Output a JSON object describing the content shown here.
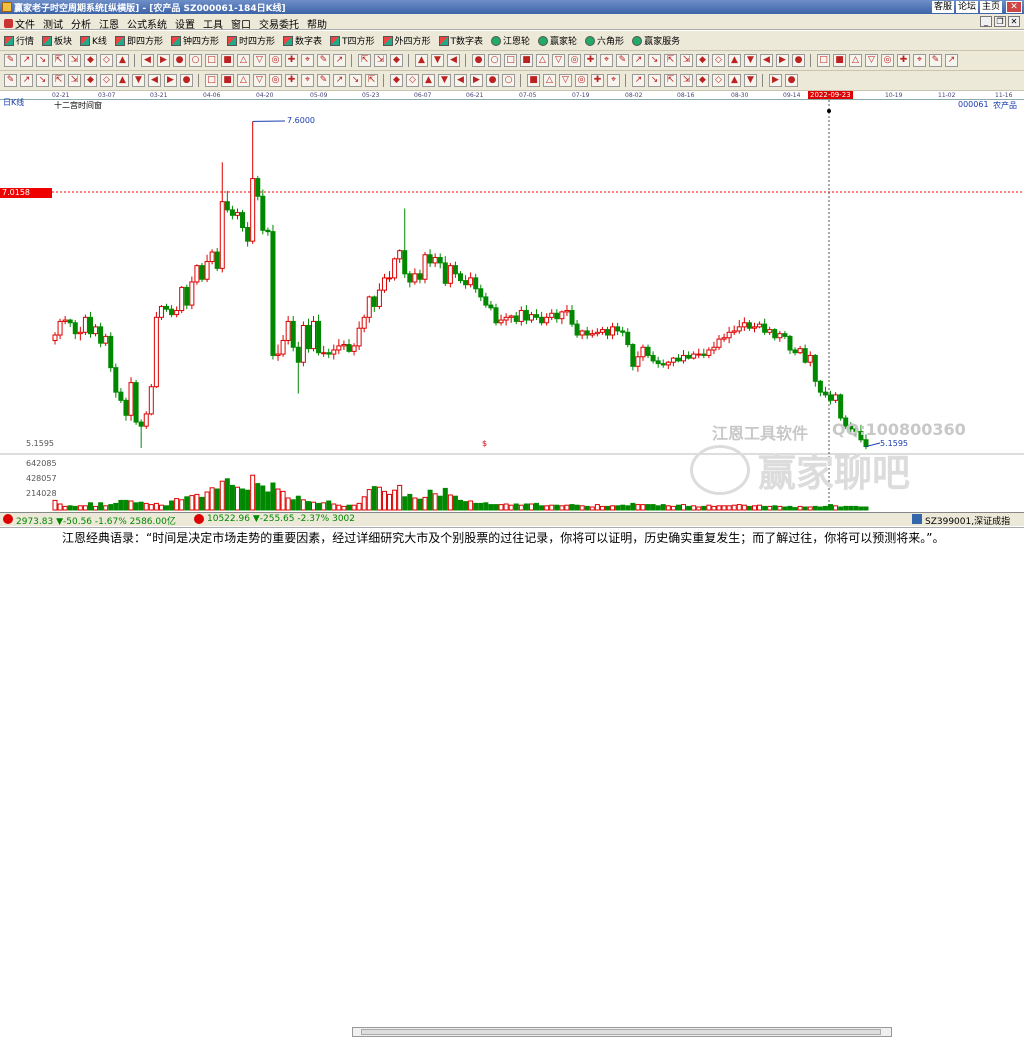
{
  "window": {
    "title": "赢家老子时空周期系统[纵横版] - [农产品   SZ000061-184日K线]",
    "links": [
      "客服",
      "论坛",
      "主页"
    ]
  },
  "menu": [
    "文件",
    "测试",
    "分析",
    "江恩",
    "公式系统",
    "设置",
    "工具",
    "窗口",
    "交易委托",
    "帮助"
  ],
  "toolbar1": [
    "行情",
    "板块",
    "K线",
    "即四方形",
    "钟四方形",
    "时四方形",
    "数字表",
    "T四方形",
    "外四方形",
    "T数字表",
    "江恩轮",
    "赢家轮",
    "六角形",
    "赢家服务"
  ],
  "date_axis": {
    "ticks": [
      "02-21",
      "03-07",
      "03-21",
      "04-06",
      "04-20",
      "05-09",
      "05-23",
      "06-07",
      "06-21",
      "07-05",
      "07-19",
      "08-02",
      "08-16",
      "08-30",
      "09-14",
      "10-19",
      "11-02",
      "11-16"
    ],
    "highlight": "2022-09-23"
  },
  "chart": {
    "period_label": "日K线",
    "window_label": "十二宫时间窗",
    "code": "000061",
    "name": "农产品",
    "high_label": "7.6000",
    "low_label": "5.1595",
    "price_flag": "7.0158",
    "left_low": "5.1595",
    "vol_labels": [
      "642085",
      "428057",
      "214028"
    ],
    "marker": "$"
  },
  "chart_data": {
    "type": "candlestick",
    "open": [
      5.95,
      5.99,
      6.09,
      6.1,
      6.08,
      6.0,
      6.01,
      6.12,
      6.0,
      6.05,
      5.93,
      5.98,
      5.75,
      5.57,
      5.51,
      5.4,
      5.64,
      5.35,
      5.32,
      5.41,
      5.61,
      6.12,
      6.2,
      6.18,
      6.14,
      6.17,
      6.34,
      6.21,
      6.38,
      6.5,
      6.4,
      6.53,
      6.6,
      6.48,
      6.97,
      6.91,
      6.87,
      6.89,
      6.78,
      6.68,
      7.14,
      7.01,
      6.76,
      6.75,
      5.84,
      5.85,
      5.95,
      6.09,
      5.9,
      5.79,
      6.06,
      5.89,
      6.09,
      5.86,
      5.86,
      5.85,
      5.88,
      5.91,
      5.92,
      5.87,
      5.91,
      6.04,
      6.12,
      6.27,
      6.2,
      6.32,
      6.41,
      6.41,
      6.55,
      6.61,
      6.44,
      6.38,
      6.44,
      6.4,
      6.58,
      6.52,
      6.56,
      6.52,
      6.37,
      6.5,
      6.44,
      6.39,
      6.36,
      6.41,
      6.33,
      6.27,
      6.21,
      6.19,
      6.08,
      6.1,
      6.12,
      6.13,
      6.09,
      6.17,
      6.1,
      6.14,
      6.12,
      6.08,
      6.12,
      6.15,
      6.11,
      6.16,
      6.17,
      6.07,
      5.99,
      6.02,
      5.99,
      6.0,
      6.01,
      6.03,
      5.99,
      6.05,
      6.02,
      6.01,
      5.92,
      5.76,
      5.83,
      5.9,
      5.84,
      5.8,
      5.78,
      5.77,
      5.79,
      5.82,
      5.8,
      5.84,
      5.82,
      5.85,
      5.85,
      5.84,
      5.88,
      5.9,
      5.96,
      5.97,
      6.01,
      6.02,
      6.05,
      6.08,
      6.04,
      6.05,
      6.07,
      6.01,
      6.03,
      5.97,
      6.0,
      5.98,
      5.88,
      5.86,
      5.89,
      5.79,
      5.84,
      5.65,
      5.57,
      5.55,
      5.51,
      5.55,
      5.38,
      5.32,
      5.3,
      5.28,
      5.22
    ],
    "close": [
      5.99,
      6.09,
      6.1,
      6.08,
      6.0,
      6.01,
      6.12,
      6.0,
      6.05,
      5.93,
      5.98,
      5.75,
      5.57,
      5.51,
      5.4,
      5.64,
      5.35,
      5.32,
      5.41,
      5.61,
      6.12,
      6.2,
      6.18,
      6.14,
      6.17,
      6.34,
      6.21,
      6.38,
      6.5,
      6.4,
      6.53,
      6.6,
      6.48,
      6.97,
      6.91,
      6.87,
      6.89,
      6.78,
      6.68,
      7.14,
      7.01,
      6.76,
      6.75,
      5.84,
      5.85,
      5.95,
      6.09,
      5.9,
      5.79,
      6.06,
      5.89,
      6.09,
      5.86,
      5.86,
      5.85,
      5.88,
      5.91,
      5.92,
      5.87,
      5.91,
      6.04,
      6.12,
      6.27,
      6.2,
      6.32,
      6.41,
      6.41,
      6.55,
      6.61,
      6.44,
      6.38,
      6.44,
      6.4,
      6.58,
      6.52,
      6.56,
      6.52,
      6.37,
      6.5,
      6.44,
      6.39,
      6.36,
      6.41,
      6.33,
      6.27,
      6.21,
      6.19,
      6.08,
      6.1,
      6.12,
      6.13,
      6.09,
      6.17,
      6.1,
      6.14,
      6.12,
      6.08,
      6.12,
      6.15,
      6.11,
      6.16,
      6.17,
      6.07,
      5.99,
      6.02,
      5.99,
      6.0,
      6.01,
      6.03,
      5.99,
      6.05,
      6.02,
      6.01,
      5.92,
      5.76,
      5.83,
      5.9,
      5.84,
      5.8,
      5.78,
      5.77,
      5.79,
      5.82,
      5.8,
      5.84,
      5.82,
      5.85,
      5.85,
      5.84,
      5.88,
      5.9,
      5.96,
      5.97,
      6.01,
      6.02,
      6.05,
      6.08,
      6.04,
      6.05,
      6.07,
      6.01,
      6.03,
      5.97,
      6.0,
      5.98,
      5.88,
      5.86,
      5.89,
      5.79,
      5.84,
      5.65,
      5.57,
      5.55,
      5.51,
      5.55,
      5.38,
      5.32,
      5.3,
      5.28,
      5.22,
      5.17
    ],
    "high": [
      6.01,
      6.11,
      6.13,
      6.11,
      6.1,
      6.05,
      6.14,
      6.16,
      6.07,
      6.08,
      6.0,
      6.01,
      5.78,
      5.6,
      5.53,
      5.68,
      5.66,
      5.37,
      5.43,
      5.63,
      6.16,
      6.21,
      6.22,
      6.21,
      6.2,
      6.35,
      6.36,
      6.42,
      6.51,
      6.52,
      6.58,
      6.62,
      6.63,
      7.26,
      7.05,
      6.94,
      6.92,
      6.91,
      6.82,
      7.56,
      7.16,
      7.06,
      6.78,
      6.8,
      5.92,
      5.99,
      6.13,
      6.13,
      5.94,
      6.09,
      6.11,
      6.13,
      6.14,
      5.91,
      5.89,
      5.92,
      5.96,
      5.95,
      5.96,
      5.93,
      6.09,
      6.14,
      6.28,
      6.28,
      6.37,
      6.44,
      6.46,
      6.56,
      6.62,
      6.92,
      6.46,
      6.48,
      6.47,
      6.6,
      6.62,
      6.59,
      6.59,
      6.57,
      6.52,
      6.53,
      6.46,
      6.43,
      6.45,
      6.44,
      6.36,
      6.3,
      6.24,
      6.22,
      6.14,
      6.15,
      6.14,
      6.16,
      6.2,
      6.21,
      6.16,
      6.18,
      6.16,
      6.15,
      6.18,
      6.18,
      6.17,
      6.21,
      6.21,
      6.1,
      6.03,
      6.05,
      6.03,
      6.04,
      6.05,
      6.05,
      6.08,
      6.08,
      6.05,
      6.04,
      5.93,
      5.87,
      5.92,
      5.92,
      5.87,
      5.83,
      5.81,
      5.8,
      5.83,
      5.85,
      5.88,
      5.87,
      5.87,
      5.89,
      5.89,
      5.9,
      5.94,
      5.99,
      6.0,
      6.05,
      6.06,
      6.1,
      6.12,
      6.1,
      6.08,
      6.09,
      6.11,
      6.05,
      6.04,
      6.02,
      6.02,
      5.99,
      5.9,
      5.91,
      5.92,
      5.87,
      5.85,
      5.66,
      5.61,
      5.58,
      5.57,
      5.56,
      5.4,
      5.35,
      5.33,
      5.33,
      5.26
    ],
    "low": [
      5.92,
      5.96,
      6.07,
      6.05,
      5.96,
      5.95,
      5.99,
      5.97,
      5.98,
      5.9,
      5.91,
      5.72,
      5.53,
      5.49,
      5.36,
      5.36,
      5.33,
      5.16,
      5.3,
      5.4,
      5.6,
      6.1,
      6.16,
      6.12,
      6.12,
      6.15,
      6.18,
      6.18,
      6.36,
      6.38,
      6.38,
      6.51,
      6.46,
      6.45,
      6.89,
      6.84,
      6.84,
      6.75,
      6.64,
      6.66,
      6.98,
      6.73,
      6.72,
      5.81,
      5.8,
      5.83,
      5.92,
      5.87,
      5.56,
      5.76,
      5.86,
      5.87,
      5.84,
      5.83,
      5.82,
      5.81,
      5.85,
      5.88,
      5.86,
      5.84,
      5.88,
      6.01,
      6.08,
      6.16,
      6.18,
      6.3,
      6.38,
      6.39,
      6.52,
      6.41,
      6.34,
      6.36,
      6.37,
      6.37,
      6.49,
      6.49,
      6.48,
      6.35,
      6.34,
      6.41,
      6.37,
      6.33,
      6.34,
      6.3,
      6.24,
      6.19,
      6.17,
      6.06,
      6.06,
      6.06,
      6.08,
      6.07,
      6.06,
      6.07,
      6.08,
      6.1,
      6.06,
      6.06,
      6.1,
      6.08,
      6.07,
      6.13,
      6.05,
      5.97,
      5.96,
      5.96,
      5.97,
      5.98,
      5.99,
      5.96,
      5.96,
      5.99,
      5.98,
      5.9,
      5.73,
      5.72,
      5.8,
      5.82,
      5.78,
      5.75,
      5.75,
      5.74,
      5.76,
      5.79,
      5.78,
      5.81,
      5.81,
      5.82,
      5.82,
      5.82,
      5.85,
      5.88,
      5.94,
      5.93,
      5.99,
      6.0,
      6.02,
      6.02,
      6.01,
      6.04,
      5.99,
      5.99,
      5.95,
      5.94,
      5.96,
      5.85,
      5.84,
      5.85,
      5.78,
      5.76,
      5.61,
      5.54,
      5.53,
      5.48,
      5.49,
      5.36,
      5.3,
      5.27,
      5.25,
      5.2,
      5.15
    ],
    "volume": [
      0.16,
      0.1,
      0.06,
      0.07,
      0.06,
      0.07,
      0.07,
      0.12,
      0.06,
      0.12,
      0.07,
      0.09,
      0.11,
      0.16,
      0.16,
      0.15,
      0.12,
      0.13,
      0.11,
      0.09,
      0.11,
      0.08,
      0.07,
      0.15,
      0.19,
      0.17,
      0.22,
      0.24,
      0.26,
      0.21,
      0.3,
      0.37,
      0.35,
      0.48,
      0.52,
      0.41,
      0.38,
      0.35,
      0.33,
      0.58,
      0.44,
      0.4,
      0.3,
      0.45,
      0.35,
      0.31,
      0.2,
      0.17,
      0.23,
      0.17,
      0.14,
      0.13,
      0.11,
      0.12,
      0.15,
      0.1,
      0.08,
      0.06,
      0.08,
      0.08,
      0.11,
      0.22,
      0.34,
      0.39,
      0.38,
      0.31,
      0.26,
      0.33,
      0.41,
      0.22,
      0.26,
      0.2,
      0.18,
      0.21,
      0.33,
      0.27,
      0.23,
      0.36,
      0.25,
      0.23,
      0.16,
      0.14,
      0.15,
      0.11,
      0.11,
      0.12,
      0.09,
      0.09,
      0.09,
      0.1,
      0.08,
      0.1,
      0.08,
      0.1,
      0.1,
      0.11,
      0.07,
      0.07,
      0.08,
      0.08,
      0.07,
      0.08,
      0.09,
      0.08,
      0.07,
      0.06,
      0.05,
      0.09,
      0.06,
      0.06,
      0.07,
      0.07,
      0.08,
      0.07,
      0.11,
      0.09,
      0.09,
      0.09,
      0.09,
      0.07,
      0.09,
      0.07,
      0.06,
      0.08,
      0.09,
      0.06,
      0.07,
      0.05,
      0.06,
      0.08,
      0.06,
      0.07,
      0.07,
      0.07,
      0.08,
      0.09,
      0.08,
      0.06,
      0.07,
      0.08,
      0.06,
      0.06,
      0.07,
      0.06,
      0.05,
      0.06,
      0.04,
      0.06,
      0.05,
      0.05,
      0.06,
      0.05,
      0.06,
      0.09,
      0.07,
      0.05,
      0.06,
      0.06,
      0.06,
      0.05,
      0.05,
      0.05,
      0.06,
      0.06
    ],
    "volume_unit": "fraction of pane height",
    "ylim": [
      5.1595,
      7.6
    ]
  },
  "ticker": {
    "idx1": "2973.83",
    "chg1": "-50.56",
    "pct1": "-1.67%",
    "vol1": "2586.00亿",
    "idx2": "10522.96",
    "chg2": "-255.65",
    "pct2": "-2.37%",
    "vol2": "3002",
    "right": "SZ399001,深证成指"
  },
  "quote": "江恩经典语录：“时间是决定市场走势的重要因素，经过详细研究大市及个别股票的过往记录，你将可以证明，历史确实重复发生；而了解过往，你将可以预测将来。”。",
  "watermark": {
    "t1": "江恩工具软件",
    "t2": "QQ:100800360",
    "brand": "赢家聊吧"
  }
}
